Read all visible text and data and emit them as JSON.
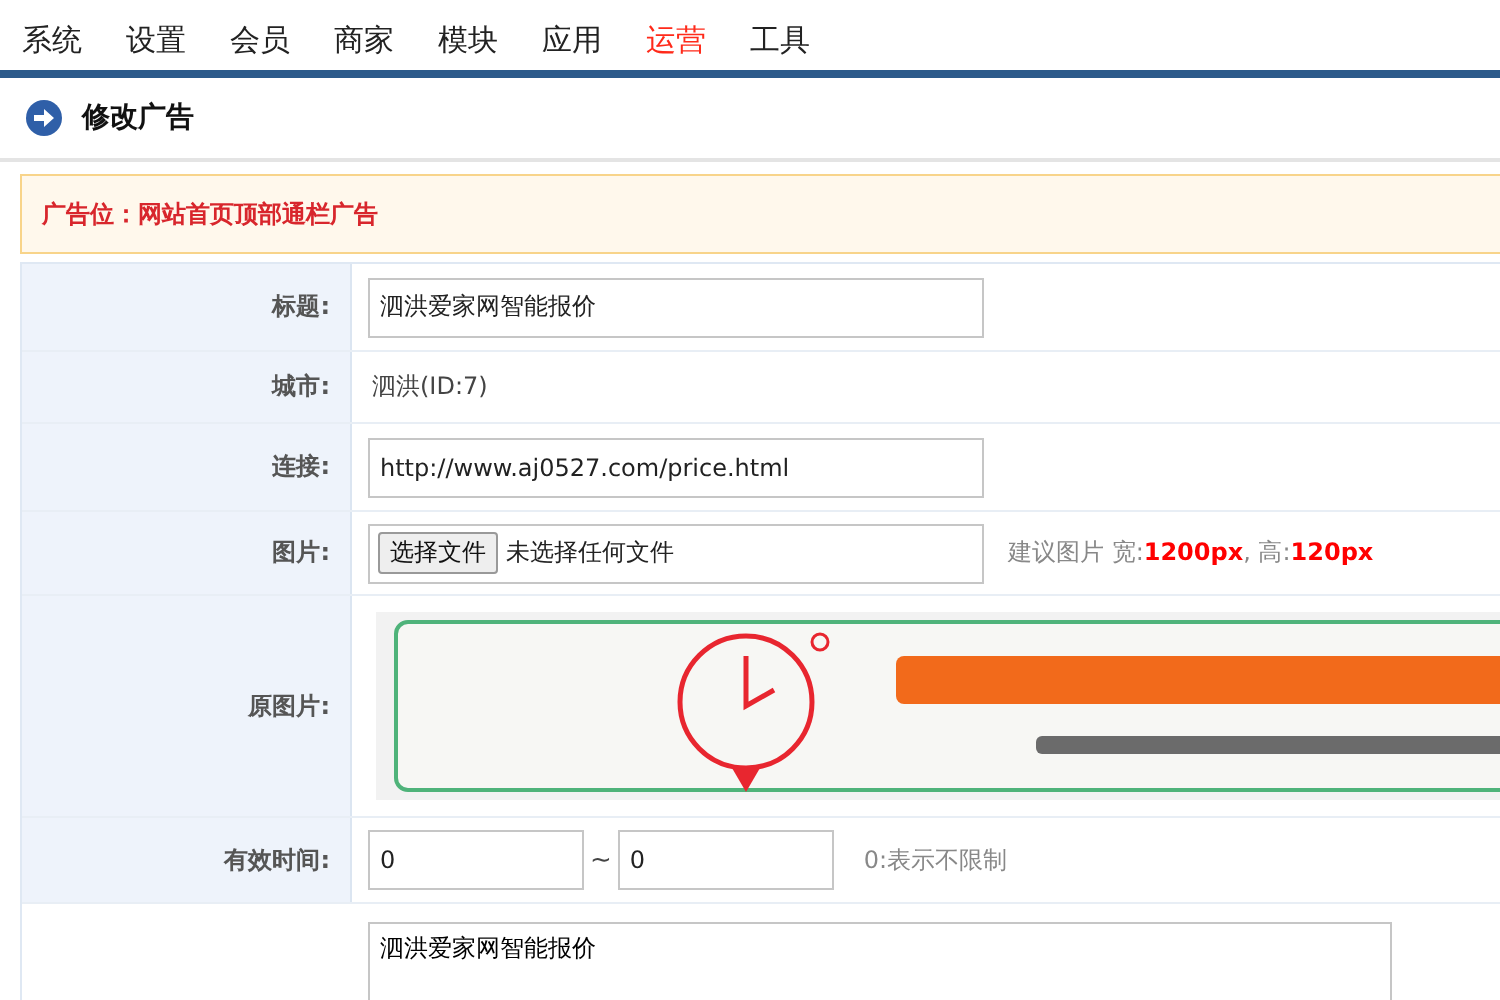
{
  "nav": {
    "items": [
      {
        "label": "系统",
        "selected": false
      },
      {
        "label": "设置",
        "selected": false
      },
      {
        "label": "会员",
        "selected": false
      },
      {
        "label": "商家",
        "selected": false
      },
      {
        "label": "模块",
        "selected": false
      },
      {
        "label": "应用",
        "selected": false
      },
      {
        "label": "运营",
        "selected": true
      },
      {
        "label": "工具",
        "selected": false
      }
    ]
  },
  "page_title": "修改广告",
  "notice": "广告位：网站首页顶部通栏广告",
  "form": {
    "rows": [
      {
        "kind": "input",
        "label": "标题:",
        "value": "泗洪爱家网智能报价"
      },
      {
        "kind": "text",
        "label": "城市:",
        "value": "泗洪(ID:7)"
      },
      {
        "kind": "input",
        "label": "连接:",
        "value": "http://www.aj0527.com/price.html"
      },
      {
        "kind": "file",
        "label": "图片:",
        "button": "选择文件",
        "status": "未选择任何文件",
        "hint": "建议图片 宽:**1200px**, 高:**120px**"
      },
      {
        "label": "原图片:"
      },
      {
        "kind": "range",
        "label": "有效时间:",
        "from": "0",
        "separator": "~",
        "to": "0",
        "hint": "0:表示不限制"
      },
      {
        "kind": "textarea",
        "value": "泗洪爱家网智能报价"
      }
    ]
  }
}
